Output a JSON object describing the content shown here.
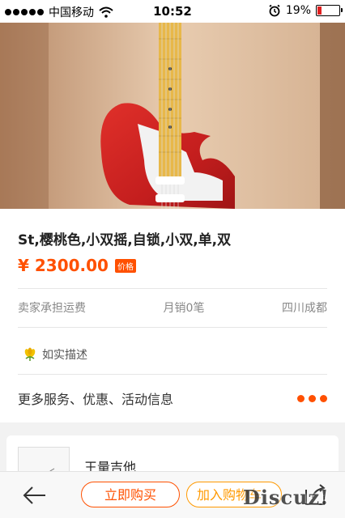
{
  "status_bar": {
    "carrier": "中国移动",
    "time": "10:52",
    "battery_percent": "19%",
    "battery_level": 0.19
  },
  "product": {
    "image_icon": "guitar-photo",
    "title": "St,樱桃色,小双摇,自锁,小双,单,双",
    "price": "¥ 2300.00",
    "price_badge": "价格",
    "shipping": "卖家承担运费",
    "sales": "月销0笔",
    "location": "四川成都",
    "description_tag": "如实描述",
    "services_label": "更多服务、优惠、活动信息"
  },
  "shop": {
    "name": "王量吉他"
  },
  "bottom_bar": {
    "buy_now": "立即购买",
    "add_to_cart": "加入购物车",
    "watermark": "Discuz!"
  },
  "colors": {
    "accent": "#ff5000",
    "cart": "#ff9900"
  }
}
